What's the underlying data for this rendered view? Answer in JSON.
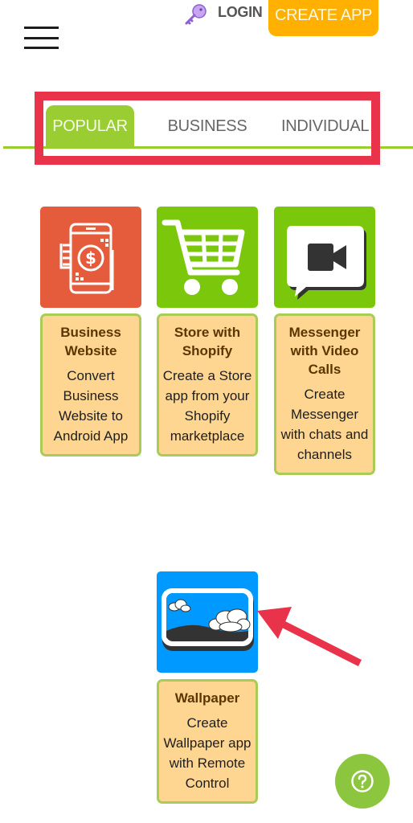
{
  "header": {
    "menu_icon": "hamburger-menu-icon",
    "login_icon": "key-icon",
    "login_label": "LOGIN",
    "create_app_label": "CREATE APP",
    "create_app_color": "#ffb000"
  },
  "tabs": [
    {
      "label": "POPULAR",
      "active": true
    },
    {
      "label": "BUSINESS",
      "active": false
    },
    {
      "label": "INDIVIDUAL",
      "active": false
    }
  ],
  "accent_color": "#9acd32",
  "highlight_color": "#e8334a",
  "apps": [
    {
      "title": "Business Website",
      "description": "Convert Business Website to Android App",
      "icon": "mobile-payment-icon",
      "tile_color": "#e55c3d"
    },
    {
      "title": "Store with Shopify",
      "description": "Create a Store app from your Shopify marketplace",
      "icon": "shopping-cart-icon",
      "tile_color": "#7ac70c"
    },
    {
      "title": "Messenger with Video Calls",
      "description": "Create Messenger with chats and channels",
      "icon": "video-chat-icon",
      "tile_color": "#7ac70c"
    },
    {
      "title": "Wallpaper",
      "description": "Create Wallpaper app with Remote Control",
      "icon": "landscape-image-icon",
      "tile_color": "#0099ff"
    }
  ],
  "help_button": {
    "icon": "help-question-icon"
  }
}
